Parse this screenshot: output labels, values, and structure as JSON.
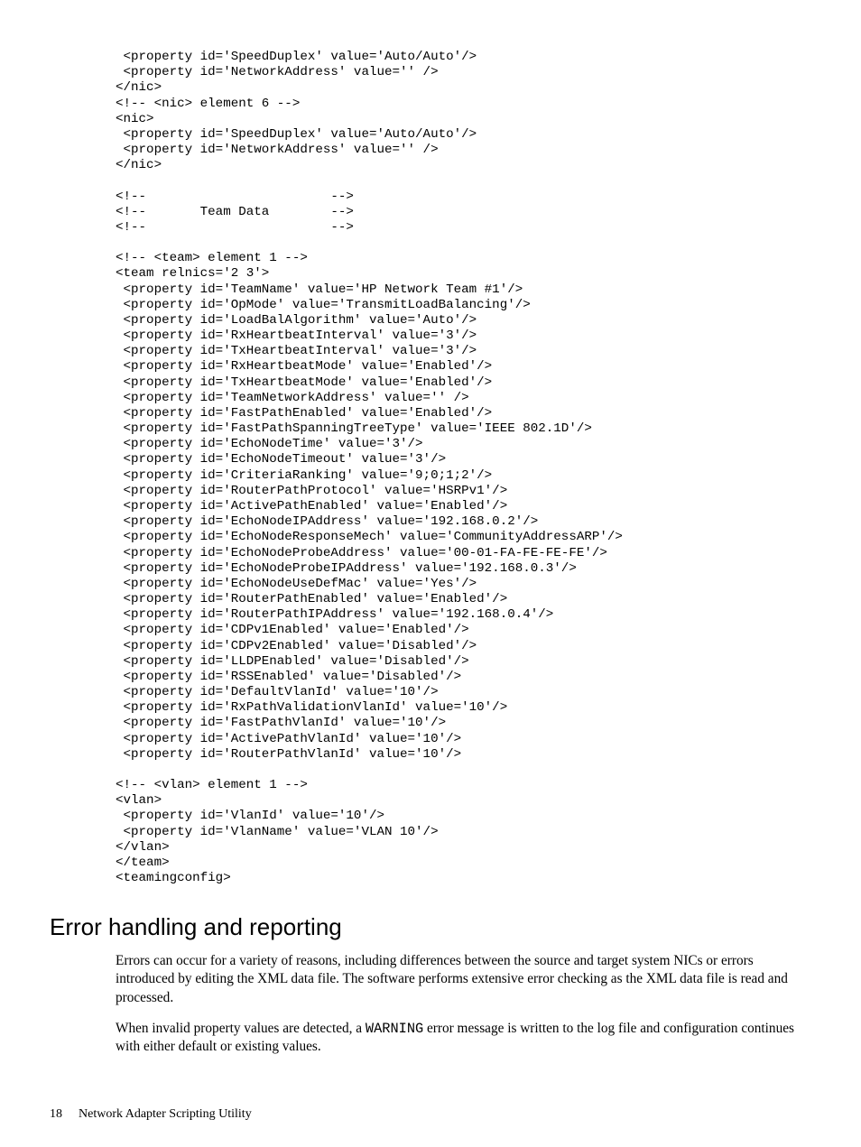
{
  "code": " <property id='SpeedDuplex' value='Auto/Auto'/>\n <property id='NetworkAddress' value='' />\n</nic>\n<!-- <nic> element 6 -->\n<nic>\n <property id='SpeedDuplex' value='Auto/Auto'/>\n <property id='NetworkAddress' value='' />\n</nic>\n\n<!--                        -->\n<!--       Team Data        -->\n<!--                        -->\n\n<!-- <team> element 1 -->\n<team relnics='2 3'>\n <property id='TeamName' value='HP Network Team #1'/>\n <property id='OpMode' value='TransmitLoadBalancing'/>\n <property id='LoadBalAlgorithm' value='Auto'/>\n <property id='RxHeartbeatInterval' value='3'/>\n <property id='TxHeartbeatInterval' value='3'/>\n <property id='RxHeartbeatMode' value='Enabled'/>\n <property id='TxHeartbeatMode' value='Enabled'/>\n <property id='TeamNetworkAddress' value='' />\n <property id='FastPathEnabled' value='Enabled'/>\n <property id='FastPathSpanningTreeType' value='IEEE 802.1D'/>\n <property id='EchoNodeTime' value='3'/>\n <property id='EchoNodeTimeout' value='3'/>\n <property id='CriteriaRanking' value='9;0;1;2'/>\n <property id='RouterPathProtocol' value='HSRPv1'/>\n <property id='ActivePathEnabled' value='Enabled'/>\n <property id='EchoNodeIPAddress' value='192.168.0.2'/>\n <property id='EchoNodeResponseMech' value='CommunityAddressARP'/>\n <property id='EchoNodeProbeAddress' value='00-01-FA-FE-FE-FE'/>\n <property id='EchoNodeProbeIPAddress' value='192.168.0.3'/>\n <property id='EchoNodeUseDefMac' value='Yes'/>\n <property id='RouterPathEnabled' value='Enabled'/>\n <property id='RouterPathIPAddress' value='192.168.0.4'/>\n <property id='CDPv1Enabled' value='Enabled'/>\n <property id='CDPv2Enabled' value='Disabled'/>\n <property id='LLDPEnabled' value='Disabled'/>\n <property id='RSSEnabled' value='Disabled'/>\n <property id='DefaultVlanId' value='10'/>\n <property id='RxPathValidationVlanId' value='10'/>\n <property id='FastPathVlanId' value='10'/>\n <property id='ActivePathVlanId' value='10'/>\n <property id='RouterPathVlanId' value='10'/>\n\n<!-- <vlan> element 1 -->\n<vlan>\n <property id='VlanId' value='10'/>\n <property id='VlanName' value='VLAN 10'/>\n</vlan>\n</team>\n<teamingconfig>",
  "heading": "Error handling and reporting",
  "para1_a": "Errors can occur for a variety of reasons, including differences between the source and target system NICs or errors introduced by editing the XML data file. The software performs extensive error checking as the XML data file is read and processed.",
  "para2_a": "When invalid property values are detected, a ",
  "para2_code": "WARNING",
  "para2_b": " error message is written to the log file and configuration continues with either default or existing values.",
  "footer_pagenum": "18",
  "footer_title": "Network Adapter Scripting Utility"
}
